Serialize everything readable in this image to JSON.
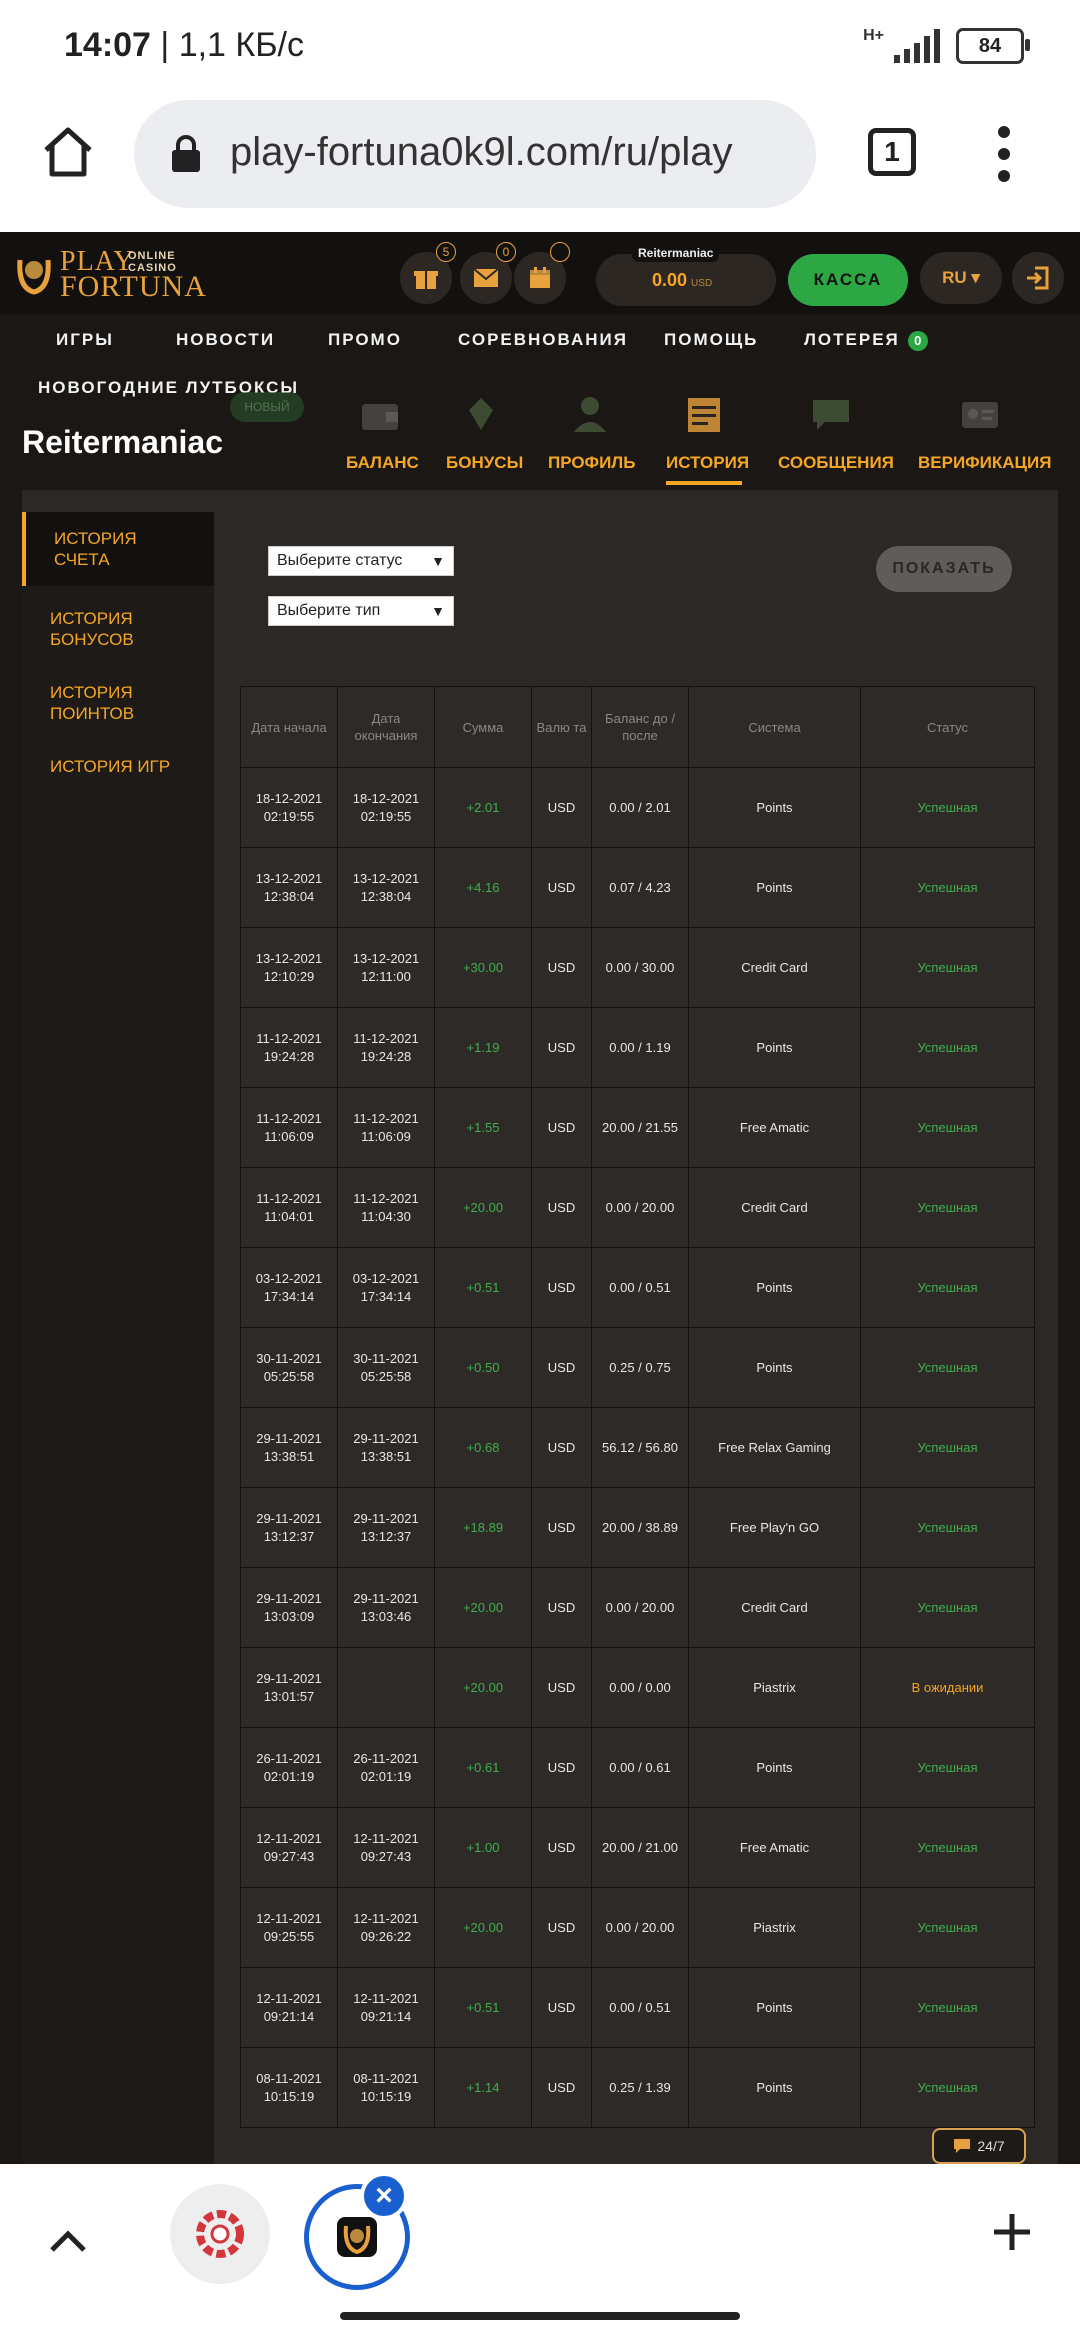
{
  "status_bar": {
    "time": "14:07",
    "speed": "1,1 КБ/с",
    "network": "H+",
    "battery": "84"
  },
  "browser": {
    "url": "play-fortuna0k9l.com/ru/play",
    "tab_count": "1"
  },
  "site": {
    "logo": {
      "play": "PLAY",
      "online_casino": "ONLINE CASINO",
      "fortuna": "FORTUNA"
    },
    "header_badges": {
      "gifts": "5",
      "messages": "0",
      "calendar": ""
    },
    "user": {
      "username": "Reitermaniac",
      "balance": "0.00",
      "currency": "USD"
    },
    "kassa_label": "КАССА",
    "lang": "RU ▾",
    "nav": [
      {
        "label": "ИГРЫ"
      },
      {
        "label": "НОВОСТИ"
      },
      {
        "label": "ПРОМО"
      },
      {
        "label": "СОРЕВНОВАНИЯ"
      },
      {
        "label": "ПОМОЩЬ"
      },
      {
        "label": "ЛОТЕРЕЯ"
      }
    ],
    "lottery_badge": "0",
    "nav_second": "НОВОГОДНИЕ ЛУТБОКСЫ",
    "page_title": "Reitermaniac",
    "new_label": "НОВЫЙ",
    "subtabs": [
      {
        "label": "БАЛАНС"
      },
      {
        "label": "БОНУСЫ"
      },
      {
        "label": "ПРОФИЛЬ"
      },
      {
        "label": "ИСТОРИЯ"
      },
      {
        "label": "СООБЩЕНИЯ"
      },
      {
        "label": "ВЕРИФИКАЦИЯ"
      }
    ],
    "sidebar": [
      {
        "label": "ИСТОРИЯ СЧЕТА"
      },
      {
        "label": "ИСТОРИЯ БОНУСОВ"
      },
      {
        "label": "ИСТОРИЯ ПОИНТОВ"
      },
      {
        "label": "ИСТОРИЯ ИГР"
      }
    ],
    "filters": {
      "status_placeholder": "Выберите статус",
      "type_placeholder": "Выберите тип",
      "show_button": "ПОКАЗАТЬ"
    },
    "table": {
      "headers": [
        "Дата начала",
        "Дата окончания",
        "Сумма",
        "Валю та",
        "Баланс до / после",
        "Система",
        "Статус"
      ],
      "rows": [
        [
          "18-12-2021 02:19:55",
          "18-12-2021 02:19:55",
          "+2.01",
          "USD",
          "0.00 / 2.01",
          "Points",
          "Успешная"
        ],
        [
          "13-12-2021 12:38:04",
          "13-12-2021 12:38:04",
          "+4.16",
          "USD",
          "0.07 / 4.23",
          "Points",
          "Успешная"
        ],
        [
          "13-12-2021 12:10:29",
          "13-12-2021 12:11:00",
          "+30.00",
          "USD",
          "0.00 / 30.00",
          "Credit Card",
          "Успешная"
        ],
        [
          "11-12-2021 19:24:28",
          "11-12-2021 19:24:28",
          "+1.19",
          "USD",
          "0.00 / 1.19",
          "Points",
          "Успешная"
        ],
        [
          "11-12-2021 11:06:09",
          "11-12-2021 11:06:09",
          "+1.55",
          "USD",
          "20.00 / 21.55",
          "Free Amatic",
          "Успешная"
        ],
        [
          "11-12-2021 11:04:01",
          "11-12-2021 11:04:30",
          "+20.00",
          "USD",
          "0.00 / 20.00",
          "Credit Card",
          "Успешная"
        ],
        [
          "03-12-2021 17:34:14",
          "03-12-2021 17:34:14",
          "+0.51",
          "USD",
          "0.00 / 0.51",
          "Points",
          "Успешная"
        ],
        [
          "30-11-2021 05:25:58",
          "30-11-2021 05:25:58",
          "+0.50",
          "USD",
          "0.25 / 0.75",
          "Points",
          "Успешная"
        ],
        [
          "29-11-2021 13:38:51",
          "29-11-2021 13:38:51",
          "+0.68",
          "USD",
          "56.12 / 56.80",
          "Free Relax Gaming",
          "Успешная"
        ],
        [
          "29-11-2021 13:12:37",
          "29-11-2021 13:12:37",
          "+18.89",
          "USD",
          "20.00 / 38.89",
          "Free Play'n GO",
          "Успешная"
        ],
        [
          "29-11-2021 13:03:09",
          "29-11-2021 13:03:46",
          "+20.00",
          "USD",
          "0.00 / 20.00",
          "Credit Card",
          "Успешная"
        ],
        [
          "29-11-2021 13:01:57",
          "",
          "+20.00",
          "USD",
          "0.00 / 0.00",
          "Piastrix",
          "В ожидании"
        ],
        [
          "26-11-2021 02:01:19",
          "26-11-2021 02:01:19",
          "+0.61",
          "USD",
          "0.00 / 0.61",
          "Points",
          "Успешная"
        ],
        [
          "12-11-2021 09:27:43",
          "12-11-2021 09:27:43",
          "+1.00",
          "USD",
          "20.00 / 21.00",
          "Free Amatic",
          "Успешная"
        ],
        [
          "12-11-2021 09:25:55",
          "12-11-2021 09:26:22",
          "+20.00",
          "USD",
          "0.00 / 20.00",
          "Piastrix",
          "Успешная"
        ],
        [
          "12-11-2021 09:21:14",
          "12-11-2021 09:21:14",
          "+0.51",
          "USD",
          "0.00 / 0.51",
          "Points",
          "Успешная"
        ],
        [
          "08-11-2021 10:15:19",
          "08-11-2021 10:15:19",
          "+1.14",
          "USD",
          "0.25 / 1.39",
          "Points",
          "Успешная"
        ]
      ]
    },
    "chat_label": "24/7"
  },
  "colors": {
    "accent": "#f5a623",
    "success": "#3fae4f",
    "pending": "#f5a623",
    "kassa": "#2ca743",
    "browser_blue": "#1a5fd0"
  }
}
